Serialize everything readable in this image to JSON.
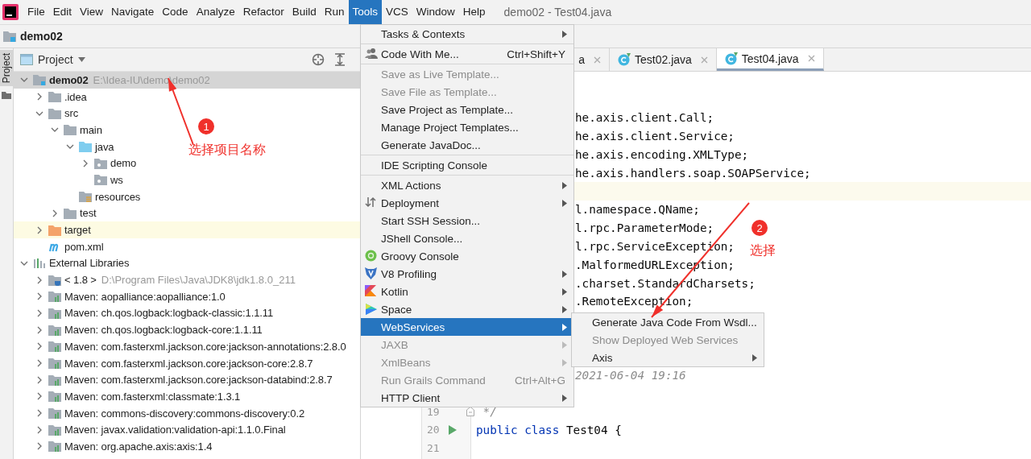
{
  "menu_bar": {
    "items": [
      {
        "label": "File",
        "selected": false
      },
      {
        "label": "Edit",
        "selected": false
      },
      {
        "label": "View",
        "selected": false
      },
      {
        "label": "Navigate",
        "selected": false
      },
      {
        "label": "Code",
        "selected": false
      },
      {
        "label": "Analyze",
        "selected": false
      },
      {
        "label": "Refactor",
        "selected": false
      },
      {
        "label": "Build",
        "selected": false
      },
      {
        "label": "Run",
        "selected": false
      },
      {
        "label": "Tools",
        "selected": true
      },
      {
        "label": "VCS",
        "selected": false
      },
      {
        "label": "Window",
        "selected": false
      },
      {
        "label": "Help",
        "selected": false
      }
    ],
    "title": "demo02 - Test04.java"
  },
  "navigation_bar": {
    "project": "demo02"
  },
  "tool_strip": {
    "tab": "Project",
    "selected": true
  },
  "project_panel": {
    "view": "Project",
    "tree": [
      {
        "label": "demo02",
        "path": "E:\\Idea-IU\\demo\\demo02",
        "kind": "module",
        "expanded": true,
        "selected": true,
        "children": [
          {
            "label": ".idea",
            "kind": "folder",
            "expanded": false,
            "selected": false
          },
          {
            "label": "src",
            "kind": "folder",
            "expanded": true,
            "selected": false,
            "children": [
              {
                "label": "main",
                "kind": "folder",
                "expanded": true,
                "selected": false,
                "children": [
                  {
                    "label": "java",
                    "kind": "source",
                    "expanded": true,
                    "selected": false,
                    "children": [
                      {
                        "label": "demo",
                        "kind": "package",
                        "expanded": false,
                        "selected": false
                      },
                      {
                        "label": "ws",
                        "kind": "package",
                        "selected": false
                      }
                    ]
                  },
                  {
                    "label": "resources",
                    "kind": "resources",
                    "selected": false
                  }
                ]
              },
              {
                "label": "test",
                "kind": "folder",
                "expanded": false,
                "selected": false
              }
            ]
          },
          {
            "label": "target",
            "kind": "excluded",
            "expanded": false,
            "selected": false
          },
          {
            "label": "pom.xml",
            "kind": "maven",
            "selected": false
          }
        ]
      },
      {
        "label": "External Libraries",
        "kind": "libraries",
        "expanded": true,
        "selected": false,
        "children": [
          {
            "label": "< 1.8 >",
            "path": "D:\\Program Files\\Java\\JDK8\\jdk1.8.0_211",
            "kind": "sdk",
            "expanded": false,
            "selected": false
          },
          {
            "label": "Maven: aopalliance:aopalliance:1.0",
            "kind": "library",
            "expanded": false,
            "selected": false
          },
          {
            "label": "Maven: ch.qos.logback:logback-classic:1.1.11",
            "kind": "library",
            "expanded": false,
            "selected": false
          },
          {
            "label": "Maven: ch.qos.logback:logback-core:1.1.11",
            "kind": "library",
            "expanded": false,
            "selected": false
          },
          {
            "label": "Maven: com.fasterxml.jackson.core:jackson-annotations:2.8.0",
            "kind": "library",
            "expanded": false,
            "selected": false
          },
          {
            "label": "Maven: com.fasterxml.jackson.core:jackson-core:2.8.7",
            "kind": "library",
            "expanded": false,
            "selected": false
          },
          {
            "label": "Maven: com.fasterxml.jackson.core:jackson-databind:2.8.7",
            "kind": "library",
            "expanded": false,
            "selected": false
          },
          {
            "label": "Maven: com.fasterxml:classmate:1.3.1",
            "kind": "library",
            "expanded": false,
            "selected": false
          },
          {
            "label": "Maven: commons-discovery:commons-discovery:0.2",
            "kind": "library",
            "expanded": false,
            "selected": false
          },
          {
            "label": "Maven: javax.validation:validation-api:1.1.0.Final",
            "kind": "library",
            "expanded": false,
            "selected": false
          },
          {
            "label": "Maven: org.apache.axis:axis:1.4",
            "kind": "library",
            "expanded": false,
            "selected": false
          }
        ]
      }
    ]
  },
  "editor": {
    "tabs": [
      {
        "label": "a",
        "kind": "clipped",
        "selected": false
      },
      {
        "label": "Test02.java",
        "kind": "class",
        "selected": false
      },
      {
        "label": "Test04.java",
        "kind": "class",
        "selected": true
      }
    ],
    "lines": [
      {
        "kind": "clipped",
        "current": false,
        "tokens": [
          {
            "text": "he.axis.client.Call;",
            "kind": "plain"
          }
        ]
      },
      {
        "kind": "clipped",
        "current": false,
        "tokens": [
          {
            "text": "he.axis.client.Service;",
            "kind": "plain"
          }
        ]
      },
      {
        "kind": "clipped",
        "current": false,
        "tokens": [
          {
            "text": "he.axis.encoding.XMLType;",
            "kind": "plain"
          }
        ]
      },
      {
        "kind": "clipped",
        "current": false,
        "tokens": [
          {
            "text": "he.axis.handlers.soap.SOAPService;",
            "kind": "plain"
          }
        ]
      },
      {
        "current": true
      },
      {
        "kind": "clipped",
        "current": false,
        "tokens": [
          {
            "text": "l.namespace.QName;",
            "kind": "plain"
          }
        ]
      },
      {
        "kind": "clipped",
        "current": false,
        "tokens": [
          {
            "text": "l.rpc.ParameterMode;",
            "kind": "plain"
          }
        ]
      },
      {
        "kind": "clipped",
        "current": false,
        "tokens": [
          {
            "text": "l.rpc.ServiceException;",
            "kind": "plain"
          }
        ]
      },
      {
        "kind": "clipped",
        "current": false,
        "tokens": [
          {
            "text": ".MalformedURLException;",
            "kind": "plain"
          }
        ]
      },
      {
        "kind": "clipped",
        "current": false,
        "tokens": [
          {
            "text": ".charset.StandardCharsets;",
            "kind": "plain"
          }
        ]
      },
      {
        "kind": "clipped",
        "current": false,
        "tokens": [
          {
            "text": ".RemoteException;",
            "kind": "plain"
          }
        ]
      },
      {
        "current": false
      },
      {
        "current": false
      },
      {
        "current": false
      },
      {
        "kind": "clipped",
        "current": false,
        "tokens": [
          {
            "text": "2021-06-04 19:16",
            "kind": "comment"
          }
        ]
      },
      {
        "current": false
      },
      {
        "number": "19",
        "kind": "fold",
        "current": false,
        "tokens": [
          {
            "text": " */",
            "kind": "comment"
          }
        ]
      },
      {
        "number": "20",
        "kind": "run",
        "current": false,
        "tokens": [
          {
            "text": "public ",
            "kind": "keyword"
          },
          {
            "text": "class ",
            "kind": "keyword"
          },
          {
            "text": "Test04 {",
            "kind": "plain"
          }
        ]
      },
      {
        "number": "21",
        "current": false
      }
    ]
  },
  "tools_menu": {
    "groups": [
      [
        {
          "label": "Tasks & Contexts",
          "submenu": true,
          "disabled": false,
          "selected": false
        }
      ],
      [
        {
          "label": "Code With Me...",
          "kind": "people",
          "shortcut": "Ctrl+Shift+Y",
          "submenu": false,
          "disabled": false,
          "selected": false
        }
      ],
      [
        {
          "label": "Save as Live Template...",
          "submenu": false,
          "disabled": true,
          "selected": false
        },
        {
          "label": "Save File as Template...",
          "submenu": false,
          "disabled": true,
          "selected": false
        },
        {
          "label": "Save Project as Template...",
          "submenu": false,
          "disabled": false,
          "selected": false
        },
        {
          "label": "Manage Project Templates...",
          "submenu": false,
          "disabled": false,
          "selected": false
        },
        {
          "label": "Generate JavaDoc...",
          "submenu": false,
          "disabled": false,
          "selected": false
        }
      ],
      [
        {
          "label": "IDE Scripting Console",
          "submenu": false,
          "disabled": false,
          "selected": false
        }
      ],
      [
        {
          "label": "XML Actions",
          "submenu": true,
          "disabled": false,
          "selected": false
        },
        {
          "label": "Deployment",
          "kind": "deploy",
          "submenu": true,
          "disabled": false,
          "selected": false
        },
        {
          "label": "Start SSH Session...",
          "submenu": false,
          "disabled": false,
          "selected": false
        },
        {
          "label": "JShell Console...",
          "submenu": false,
          "disabled": false,
          "selected": false
        },
        {
          "label": "Groovy Console",
          "kind": "groovy",
          "submenu": false,
          "disabled": false,
          "selected": false
        },
        {
          "label": "V8 Profiling",
          "kind": "v8",
          "submenu": true,
          "disabled": false,
          "selected": false
        },
        {
          "label": "Kotlin",
          "kind": "kotlin",
          "submenu": true,
          "disabled": false,
          "selected": false
        },
        {
          "label": "Space",
          "kind": "space",
          "submenu": true,
          "disabled": false,
          "selected": false
        },
        {
          "label": "WebServices",
          "submenu": true,
          "disabled": false,
          "selected": true
        },
        {
          "label": "JAXB",
          "submenu": true,
          "disabled": true,
          "selected": false
        },
        {
          "label": "XmlBeans",
          "submenu": true,
          "disabled": true,
          "selected": false
        },
        {
          "label": "Run Grails Command",
          "shortcut": "Ctrl+Alt+G",
          "submenu": false,
          "disabled": true,
          "selected": false
        },
        {
          "label": "HTTP Client",
          "submenu": true,
          "disabled": false,
          "selected": false
        }
      ]
    ]
  },
  "webservices_submenu": {
    "items": [
      {
        "label": "Generate Java Code From Wsdl...",
        "submenu": false,
        "disabled": false,
        "selected": false
      },
      {
        "label": "Show Deployed Web Services",
        "submenu": false,
        "disabled": true,
        "selected": false
      },
      {
        "label": "Axis",
        "submenu": true,
        "disabled": false,
        "selected": false
      }
    ]
  },
  "annotations": [
    {
      "number": "1",
      "text": "选择项目名称"
    },
    {
      "number": "2",
      "text": "选择"
    }
  ]
}
